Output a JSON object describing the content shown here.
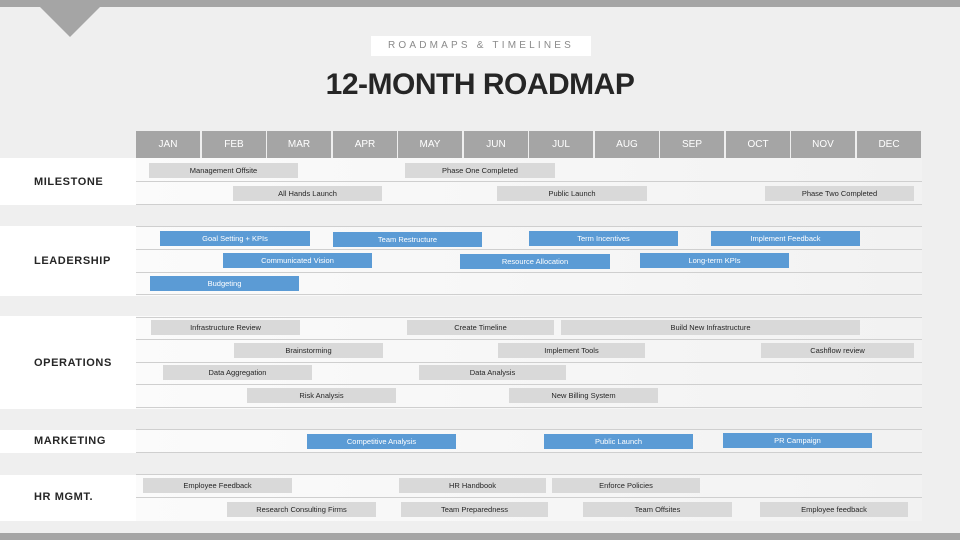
{
  "header": {
    "kicker": "ROADMAPS & TIMELINES",
    "title": "12-MONTH ROADMAP"
  },
  "colors": {
    "accent_blue": "#5b9bd5",
    "bar_gray": "#d9d9d9",
    "header_gray": "#a5a5a5"
  },
  "months": [
    "JAN",
    "FEB",
    "MAR",
    "APR",
    "MAY",
    "JUN",
    "JUL",
    "AUG",
    "SEP",
    "OCT",
    "NOV",
    "DEC"
  ],
  "sections": {
    "milestone": {
      "label": "MILESTONE",
      "rows": [
        [
          {
            "label": "Management Offsite",
            "style": "gray"
          },
          {
            "label": "Phase One Completed",
            "style": "gray"
          }
        ],
        [
          {
            "label": "All Hands Launch",
            "style": "gray"
          },
          {
            "label": "Public Launch",
            "style": "gray"
          },
          {
            "label": "Phase Two Completed",
            "style": "gray"
          }
        ]
      ]
    },
    "leadership": {
      "label": "LEADERSHIP",
      "rows": [
        [
          {
            "label": "Goal Setting + KPIs",
            "style": "blue"
          },
          {
            "label": "Team Restructure",
            "style": "blue"
          },
          {
            "label": "Term Incentives",
            "style": "blue"
          },
          {
            "label": "Implement Feedback",
            "style": "blue"
          }
        ],
        [
          {
            "label": "Communicated Vision",
            "style": "blue"
          },
          {
            "label": "Resource Allocation",
            "style": "blue"
          },
          {
            "label": "Long-term KPIs",
            "style": "blue"
          }
        ],
        [
          {
            "label": "Budgeting",
            "style": "blue"
          }
        ]
      ]
    },
    "operations": {
      "label": "OPERATIONS",
      "rows": [
        [
          {
            "label": "Infrastructure Review",
            "style": "gray"
          },
          {
            "label": "Create Timeline",
            "style": "gray"
          },
          {
            "label": "Build New Infrastructure",
            "style": "gray"
          }
        ],
        [
          {
            "label": "Brainstorming",
            "style": "gray"
          },
          {
            "label": "Implement Tools",
            "style": "gray"
          },
          {
            "label": "Cashflow review",
            "style": "gray"
          }
        ],
        [
          {
            "label": "Data Aggregation",
            "style": "gray"
          },
          {
            "label": "Data Analysis",
            "style": "gray"
          }
        ],
        [
          {
            "label": "Risk Analysis",
            "style": "gray"
          },
          {
            "label": "New Billing System",
            "style": "gray"
          }
        ]
      ]
    },
    "marketing": {
      "label": "MARKETING",
      "rows": [
        [
          {
            "label": "Competitive Analysis",
            "style": "blue"
          },
          {
            "label": "Public Launch",
            "style": "blue"
          },
          {
            "label": "PR Campaign",
            "style": "blue"
          }
        ]
      ]
    },
    "hr": {
      "label": "HR MGMT.",
      "rows": [
        [
          {
            "label": "Employee Feedback",
            "style": "gray"
          },
          {
            "label": "HR Handbook",
            "style": "gray"
          },
          {
            "label": "Enforce Policies",
            "style": "gray"
          }
        ],
        [
          {
            "label": "Research Consulting Firms",
            "style": "gray"
          },
          {
            "label": "Team Preparedness",
            "style": "gray"
          },
          {
            "label": "Team Offsites",
            "style": "gray"
          },
          {
            "label": "Employee feedback",
            "style": "gray"
          }
        ]
      ]
    }
  }
}
